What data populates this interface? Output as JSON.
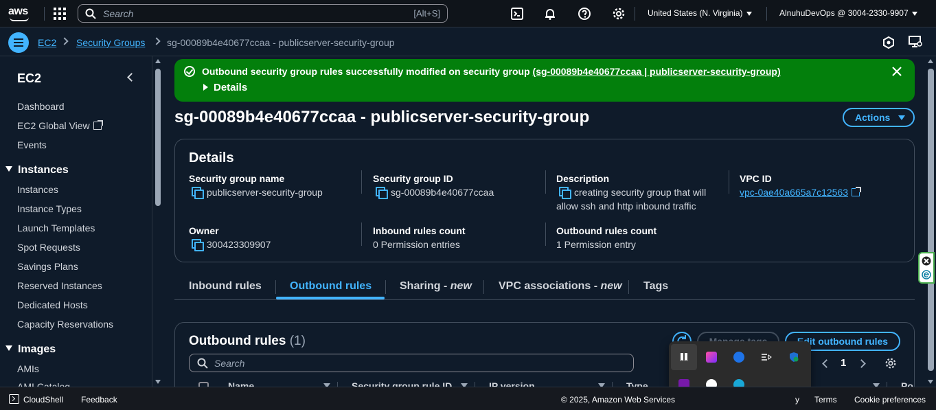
{
  "topbar": {
    "logo": "aws",
    "search_placeholder": "Search",
    "search_shortcut": "[Alt+S]",
    "region": "United States (N. Virginia)",
    "account": "AlnuhuDevOps @ 3004-2330-9907",
    "icons": [
      "grid-icon",
      "search-icon",
      "cloudshell-icon",
      "bell-icon",
      "help-icon",
      "gear-icon"
    ]
  },
  "breadcrumb": {
    "items": [
      "EC2",
      "Security Groups"
    ],
    "current": "sg-00089b4e40677ccaa - publicserver-security-group"
  },
  "sidebar": {
    "title": "EC2",
    "top_items": [
      "Dashboard",
      "EC2 Global View",
      "Events"
    ],
    "sections": [
      {
        "label": "Instances",
        "items": [
          "Instances",
          "Instance Types",
          "Launch Templates",
          "Spot Requests",
          "Savings Plans",
          "Reserved Instances",
          "Dedicated Hosts",
          "Capacity Reservations"
        ]
      },
      {
        "label": "Images",
        "items": [
          "AMIs",
          "AMI Catalog"
        ]
      }
    ]
  },
  "flash": {
    "message": "Outbound security group rules successfully modified on security group ",
    "link": "(sg-00089b4e40677ccaa | publicserver-security-group)",
    "details_label": "Details",
    "color": "#037f0c"
  },
  "page": {
    "title": "sg-00089b4e40677ccaa - publicserver-security-group",
    "actions_label": "Actions"
  },
  "details": {
    "heading": "Details",
    "fields": {
      "sg_name_label": "Security group name",
      "sg_name": "publicserver-security-group",
      "sg_id_label": "Security group ID",
      "sg_id": "sg-00089b4e40677ccaa",
      "desc_label": "Description",
      "desc_line1": "creating security group that will",
      "desc_line2": "allow ssh and http inbound traffic",
      "vpc_label": "VPC ID",
      "vpc_id": "vpc-0ae40a665a7c12563",
      "owner_label": "Owner",
      "owner": "300423309907",
      "inbound_label": "Inbound rules count",
      "inbound": "0 Permission entries",
      "outbound_label": "Outbound rules count",
      "outbound": "1 Permission entry"
    }
  },
  "tabs": {
    "inbound": "Inbound rules",
    "outbound": "Outbound rules",
    "sharing": "Sharing - ",
    "sharing_new": "new",
    "vpc": "VPC associations - ",
    "vpc_new": "new",
    "tags": "Tags",
    "active": "Outbound rules"
  },
  "outbound_panel": {
    "heading": "Outbound rules",
    "count": "(1)",
    "search_placeholder": "Search",
    "manage_tags": "Manage tags",
    "edit_rules": "Edit outbound rules",
    "page": "1",
    "columns": [
      "Name",
      "Security group rule ID",
      "IP version",
      "Type",
      "Po"
    ]
  },
  "footer": {
    "cloudshell": "CloudShell",
    "feedback": "Feedback",
    "copyright": "© 2025, Amazon Web Services",
    "privacy": "y",
    "terms": "Terms",
    "cookies": "Cookie preferences"
  },
  "colors": {
    "accent": "#42b4ff",
    "success": "#037f0c",
    "background": "#0f1b2a"
  }
}
